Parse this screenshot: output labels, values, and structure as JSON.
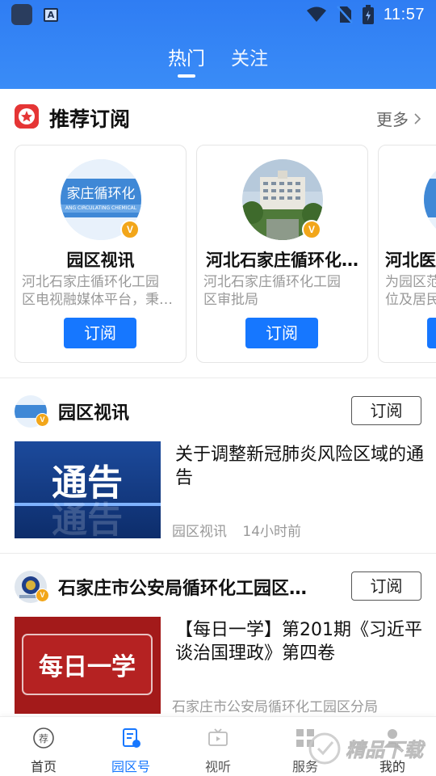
{
  "status_bar": {
    "time": "11:57"
  },
  "header": {
    "tabs": [
      {
        "label": "热门",
        "active": true
      },
      {
        "label": "关注",
        "active": false
      }
    ]
  },
  "recommended": {
    "title": "推荐订阅",
    "more_label": "更多",
    "cards": [
      {
        "name": "园区视讯",
        "desc_line1": "河北石家庄循环化工园",
        "desc_line2": "区电视融媒体平台，秉…",
        "button": "订阅",
        "avatar_text": "家庄循环化",
        "avatar_subtext": "ANG CIRCULATING CHEMICAL"
      },
      {
        "name": "河北石家庄循环化…",
        "desc_line1": "河北石家庄循环化工园",
        "desc_line2": "区审批局",
        "button": "订阅"
      },
      {
        "name": "河北医",
        "desc_line1": "为园区范",
        "desc_line2": "位及居民",
        "button": "订阅"
      }
    ],
    "verified_mark": "V"
  },
  "feed": [
    {
      "channel": "园区视讯",
      "follow_label": "订阅",
      "title": "关于调整新冠肺炎风险区域的通告",
      "source": "园区视讯",
      "time": "14小时前",
      "thumb_text": "通告"
    },
    {
      "channel": "石家庄市公安局循环化工园区…",
      "follow_label": "订阅",
      "title": "【每日一学】第201期《习近平谈治国理政》第四卷",
      "source": "石家庄市公安局循环化工园区分局",
      "time": "",
      "thumb_text": "每日一学"
    }
  ],
  "bottom_nav": [
    {
      "label": "首页",
      "icon": "recommend-icon"
    },
    {
      "label": "园区号",
      "icon": "channel-doc-icon"
    },
    {
      "label": "视听",
      "icon": "tv-icon"
    },
    {
      "label": "服务",
      "icon": "grid-icon"
    },
    {
      "label": "我的",
      "icon": "person-icon"
    }
  ],
  "watermark": {
    "text": "精品下载"
  },
  "colors": {
    "header_blue": "#3a8cf7",
    "primary": "#1677ff",
    "star_red": "#e53535",
    "badge_orange": "#f2a61a"
  }
}
